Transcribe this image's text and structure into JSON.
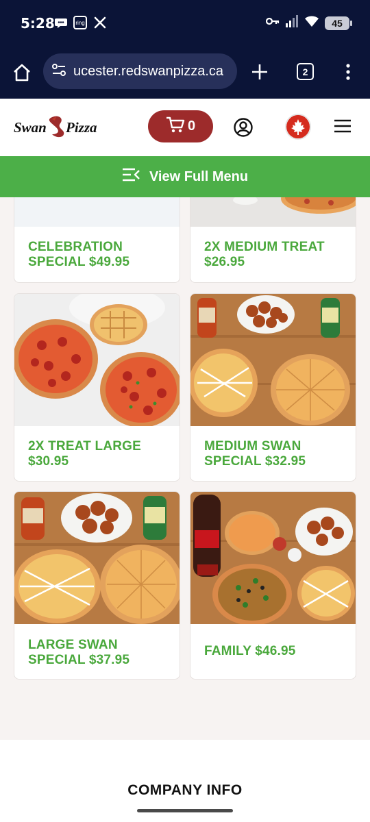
{
  "status_bar": {
    "time": "5:28",
    "battery": "45",
    "icons": [
      "chat-icon",
      "ring-icon",
      "x-icon",
      "key-icon",
      "signal-icon",
      "wifi-icon",
      "battery-icon"
    ],
    "ring_label": "ring"
  },
  "browser": {
    "url": "ucester.redswanpizza.ca",
    "tab_count": "2"
  },
  "header": {
    "logo_text_left": "Swan",
    "logo_text_right": "Pizza",
    "cart_count": "0"
  },
  "menu_bar": {
    "label": "View Full Menu"
  },
  "products": [
    {
      "title": "CELEBRATION SPECIAL $49.95"
    },
    {
      "title": "2X MEDIUM TREAT $26.95"
    },
    {
      "title": "2X TREAT LARGE $30.95"
    },
    {
      "title": "MEDIUM SWAN SPECIAL $32.95"
    },
    {
      "title": "LARGE SWAN SPECIAL $37.95"
    },
    {
      "title": "FAMILY $46.95"
    }
  ],
  "footer": {
    "company_info": "COMPANY INFO"
  },
  "colors": {
    "status_bg": "#0b1437",
    "brand_red": "#9d2b2b",
    "brand_green": "#4caf48",
    "title_green": "#4aa83c"
  }
}
